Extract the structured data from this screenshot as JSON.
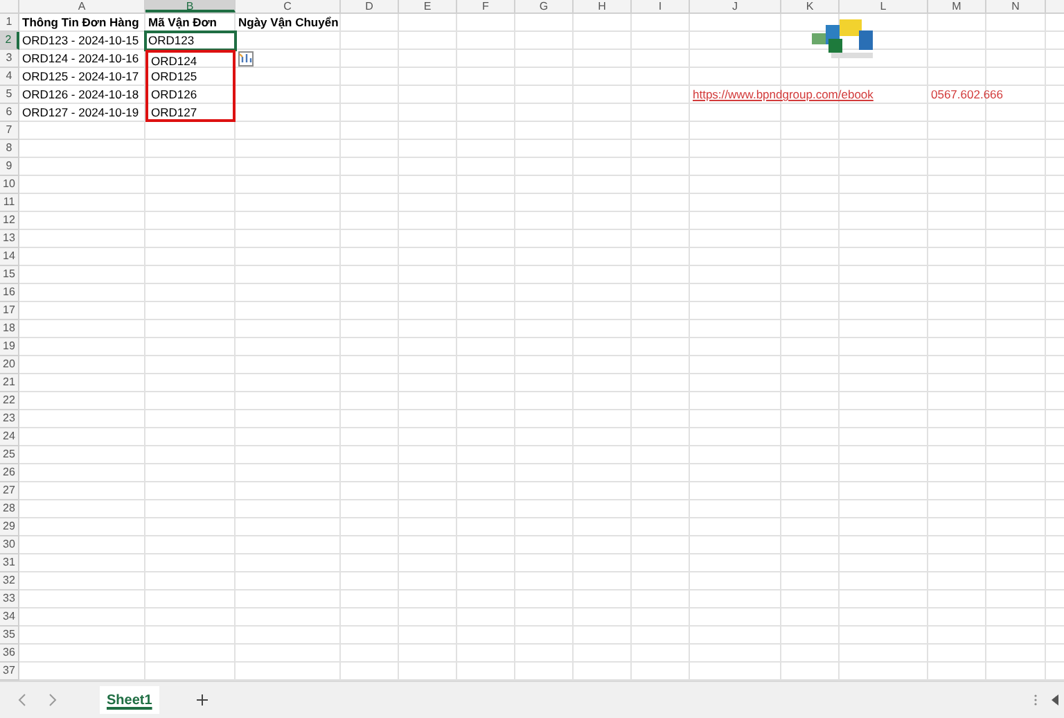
{
  "columns": [
    {
      "label": "A",
      "selected": false
    },
    {
      "label": "B",
      "selected": true
    },
    {
      "label": "C",
      "selected": false
    },
    {
      "label": "D",
      "selected": false
    },
    {
      "label": "E",
      "selected": false
    },
    {
      "label": "F",
      "selected": false
    },
    {
      "label": "G",
      "selected": false
    },
    {
      "label": "H",
      "selected": false
    },
    {
      "label": "I",
      "selected": false
    },
    {
      "label": "J",
      "selected": false
    },
    {
      "label": "K",
      "selected": false
    },
    {
      "label": "L",
      "selected": false
    },
    {
      "label": "M",
      "selected": false
    },
    {
      "label": "N",
      "selected": false
    }
  ],
  "rows": [
    {
      "number": "1",
      "selected": false,
      "cells": {
        "A": {
          "text": "Thông Tin Đơn Hàng",
          "kind": "header"
        },
        "B": {
          "text": "Mã Vận Đơn",
          "kind": "header"
        },
        "C": {
          "text": "Ngày Vận Chuyển",
          "kind": "header"
        },
        "K": {
          "kind": "logo"
        }
      }
    },
    {
      "number": "2",
      "selected": true,
      "cells": {
        "A": {
          "text": "ORD123 - 2024-10-15",
          "kind": "text"
        },
        "B": {
          "text": "ORD123",
          "kind": "text",
          "selected": true,
          "outlined": false
        }
      }
    },
    {
      "number": "3",
      "selected": false,
      "cells": {
        "A": {
          "text": "ORD124 - 2024-10-16",
          "kind": "text"
        },
        "B": {
          "text": "ORD124",
          "kind": "text",
          "selected": false,
          "outlined": true
        },
        "C": {
          "kind": "quick-analysis"
        }
      }
    },
    {
      "number": "4",
      "selected": false,
      "cells": {
        "A": {
          "text": "ORD125 - 2024-10-17",
          "kind": "text"
        },
        "B": {
          "text": "ORD125",
          "kind": "text",
          "selected": false,
          "outlined": true
        }
      }
    },
    {
      "number": "5",
      "selected": false,
      "cells": {
        "A": {
          "text": "ORD126 - 2024-10-18",
          "kind": "text"
        },
        "B": {
          "text": "ORD126",
          "kind": "text",
          "selected": false,
          "outlined": true
        },
        "J": {
          "text": "https://www.bpndgroup.com/ebook",
          "kind": "link"
        },
        "M": {
          "text": "0567.602.666",
          "kind": "accent"
        }
      }
    },
    {
      "number": "6",
      "selected": false,
      "cells": {
        "A": {
          "text": "ORD127 - 2024-10-19",
          "kind": "text"
        },
        "B": {
          "text": "ORD127",
          "kind": "text",
          "selected": false,
          "outlined": true
        }
      }
    },
    {
      "number": "7",
      "selected": false
    },
    {
      "number": "8",
      "selected": false
    },
    {
      "number": "9",
      "selected": false
    },
    {
      "number": "10",
      "selected": false
    },
    {
      "number": "11",
      "selected": false
    },
    {
      "number": "12",
      "selected": false
    },
    {
      "number": "13",
      "selected": false
    },
    {
      "number": "14",
      "selected": false
    },
    {
      "number": "15",
      "selected": false
    },
    {
      "number": "16",
      "selected": false
    },
    {
      "number": "17",
      "selected": false
    },
    {
      "number": "18",
      "selected": false
    },
    {
      "number": "19",
      "selected": false
    },
    {
      "number": "20",
      "selected": false
    },
    {
      "number": "21",
      "selected": false
    },
    {
      "number": "22",
      "selected": false
    },
    {
      "number": "23",
      "selected": false
    },
    {
      "number": "24",
      "selected": false
    },
    {
      "number": "25",
      "selected": false
    },
    {
      "number": "26",
      "selected": false
    },
    {
      "number": "27",
      "selected": false
    },
    {
      "number": "28",
      "selected": false
    },
    {
      "number": "29",
      "selected": false
    },
    {
      "number": "30",
      "selected": false
    },
    {
      "number": "31",
      "selected": false
    },
    {
      "number": "32",
      "selected": false
    },
    {
      "number": "33",
      "selected": false
    },
    {
      "number": "34",
      "selected": false
    },
    {
      "number": "35",
      "selected": false
    },
    {
      "number": "36",
      "selected": false
    },
    {
      "number": "37",
      "selected": false
    }
  ],
  "sheet_tabs": [
    {
      "label": "Sheet1",
      "selected": true
    }
  ]
}
